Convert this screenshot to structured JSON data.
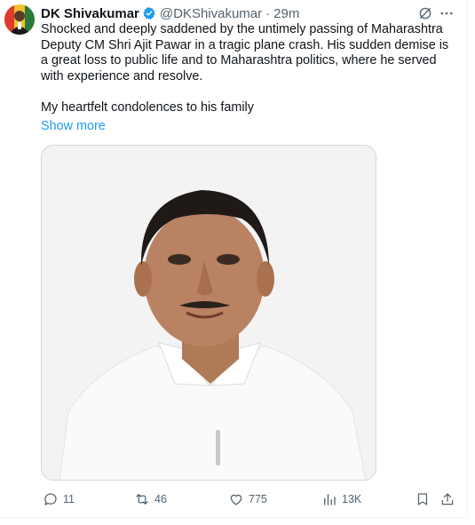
{
  "tweet": {
    "author_name": "DK Shivakumar",
    "handle": "@DKShivakumar",
    "separator": "·",
    "time": "29m",
    "text_p1": "Shocked and deeply saddened by the untimely passing of Maharashtra Deputy CM Shri Ajit Pawar in a tragic plane crash. His sudden demise is a great loss to public life and to Maharashtra politics, where he served with experience and resolve.",
    "text_p2": "My heartfelt condolences to his family",
    "show_more": "Show more"
  },
  "actions": {
    "replies": "11",
    "reposts": "46",
    "likes": "775",
    "views": "13K"
  },
  "colors": {
    "accent": "#1d9bf0",
    "secondary_text": "#536471",
    "border": "#cfd9de"
  },
  "icons": [
    "verified-badge-icon",
    "grok-icon",
    "more-icon",
    "reply-icon",
    "repost-icon",
    "like-icon",
    "views-icon",
    "bookmark-icon",
    "share-icon"
  ]
}
